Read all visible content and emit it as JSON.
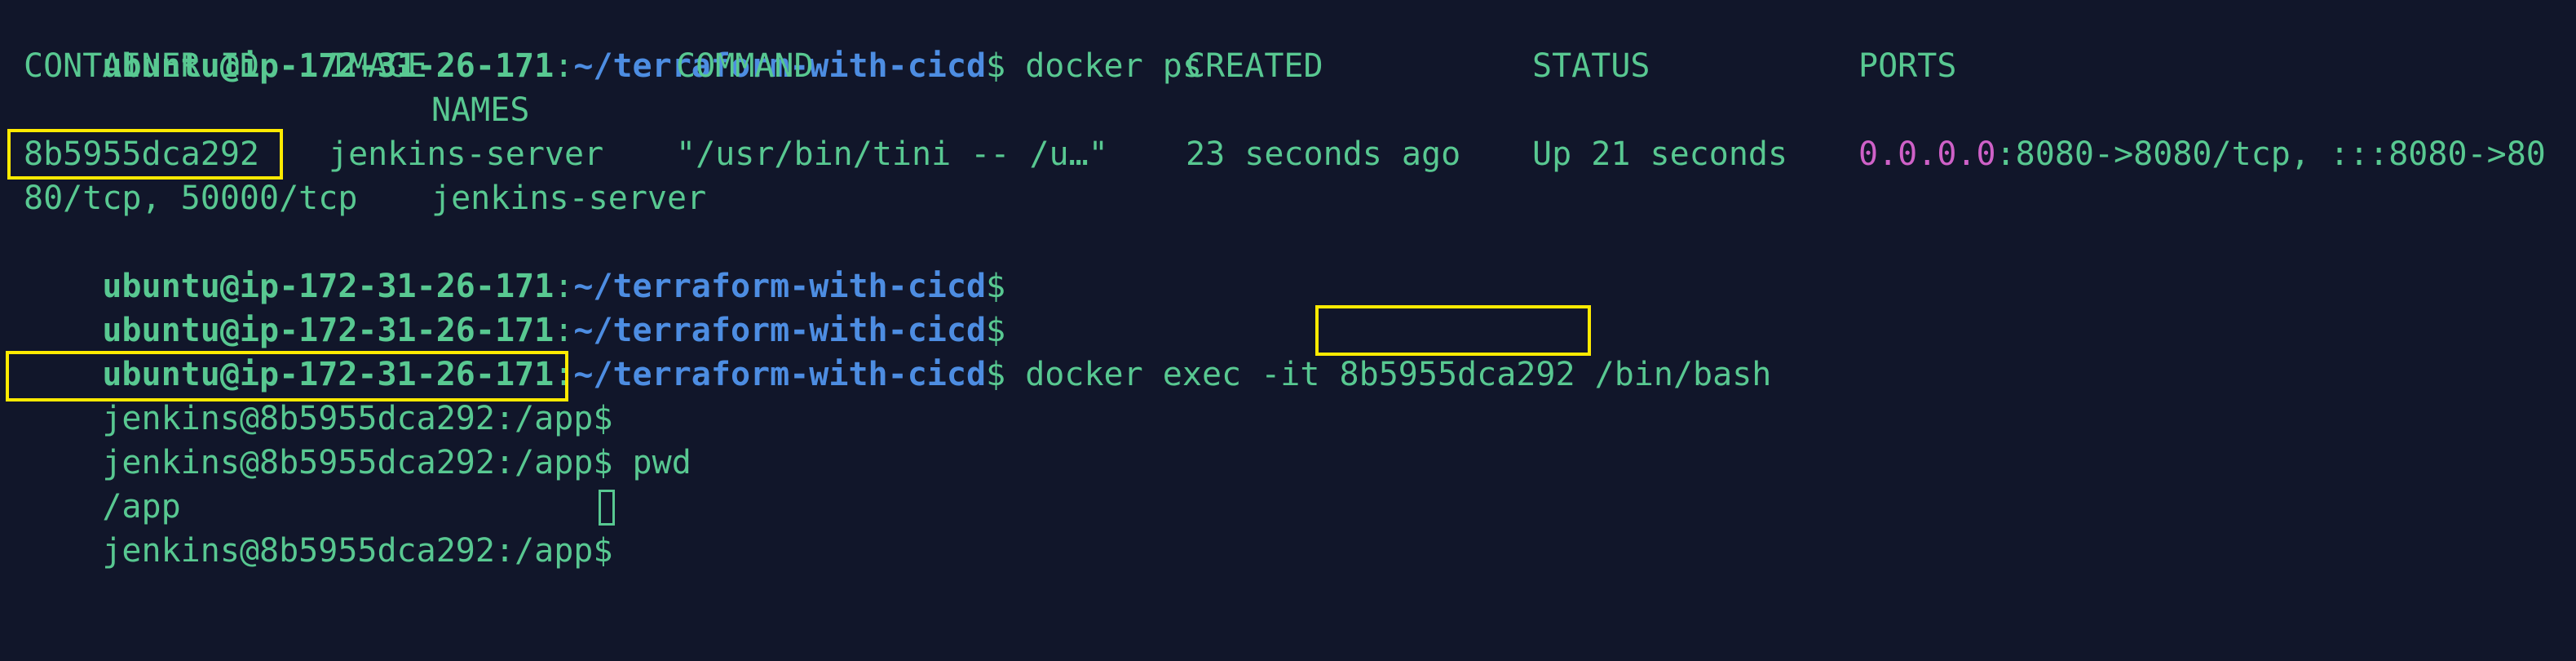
{
  "terminal": {
    "prompt": {
      "user_host": "ubuntu@ip-172-31-26-171",
      "separator": ":",
      "path": "~/terraform-with-cicd",
      "dollar": "$"
    },
    "commands": {
      "docker_ps": " docker ps",
      "docker_exec_prefix": " docker exec -it ",
      "docker_exec_id": "8b5955dca292",
      "docker_exec_suffix": " /bin/bash",
      "pwd": " pwd"
    },
    "ps_table": {
      "headers": {
        "container_id": "CONTAINER ID",
        "image": "IMAGE",
        "command": "COMMAND",
        "created": "CREATED",
        "status": "STATUS",
        "ports": "PORTS",
        "names": "NAMES"
      },
      "row": {
        "container_id": "8b5955dca292",
        "image": "jenkins-server",
        "command": "\"/usr/bin/tini -- /u…\"",
        "created": "23 seconds ago",
        "status": "Up 21 seconds",
        "ports_address": "0.0.0.0",
        "ports_rest": ":8080->8080/tcp, :::8080->80",
        "ports_wrap": "80/tcp, 50000/tcp",
        "names": "jenkins-server"
      }
    },
    "jenkins_prompt": {
      "text": "jenkins@8b5955dca292:/app$"
    },
    "output": {
      "pwd_result": "/app"
    }
  },
  "colors": {
    "background": "#11162a",
    "green": "#58c891",
    "blue": "#4d8de2",
    "magenta": "#cf61c8",
    "highlight": "#ffea00"
  }
}
